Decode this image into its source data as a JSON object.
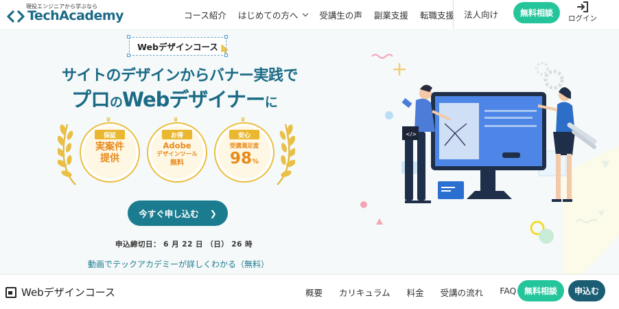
{
  "header": {
    "logo_tagline": "現役エンジニアから学ぶなら",
    "logo_text": "TechAcademy",
    "nav": [
      {
        "label": "コース紹介"
      },
      {
        "label": "はじめての方へ"
      },
      {
        "label": "受講生の声"
      },
      {
        "label": "副業支援"
      },
      {
        "label": "転職支援"
      }
    ],
    "corporate": "法人向け",
    "free_consult": "無料相談",
    "login": "ログイン"
  },
  "hero": {
    "course_tag": "Webデザインコース",
    "title_line1": "サイトのデザインからバナー実践で",
    "title_line2a": "プロ",
    "title_line2b": "の",
    "title_line2c": "Webデザイナー",
    "title_line2d": "に",
    "badges": [
      {
        "ribbon": "保証",
        "line1": "実案件",
        "line2": "提供"
      },
      {
        "ribbon": "お得",
        "line1": "Adobe",
        "line2": "デザインツール",
        "line3": "無料"
      },
      {
        "ribbon": "安心",
        "line1": "受講満足度",
        "value": "98",
        "unit": "%"
      }
    ],
    "cta": "今すぐ申し込む",
    "deadline": "申込締切日： 6 月 22 日 （日） 26 時",
    "video_link": "動画でテックアカデミーが詳しくわかる（無料）"
  },
  "subnav": {
    "title": "Webデザインコース",
    "links": [
      {
        "label": "概要"
      },
      {
        "label": "カリキュラム"
      },
      {
        "label": "料金"
      },
      {
        "label": "受講の流れ"
      },
      {
        "label": "FAQ"
      }
    ],
    "free_consult": "無料相談",
    "apply": "申込む"
  },
  "colors": {
    "brand": "#1b6a86",
    "accent_green": "#25c59b",
    "gold": "#e9b830",
    "dark_button": "#1b5d73"
  }
}
